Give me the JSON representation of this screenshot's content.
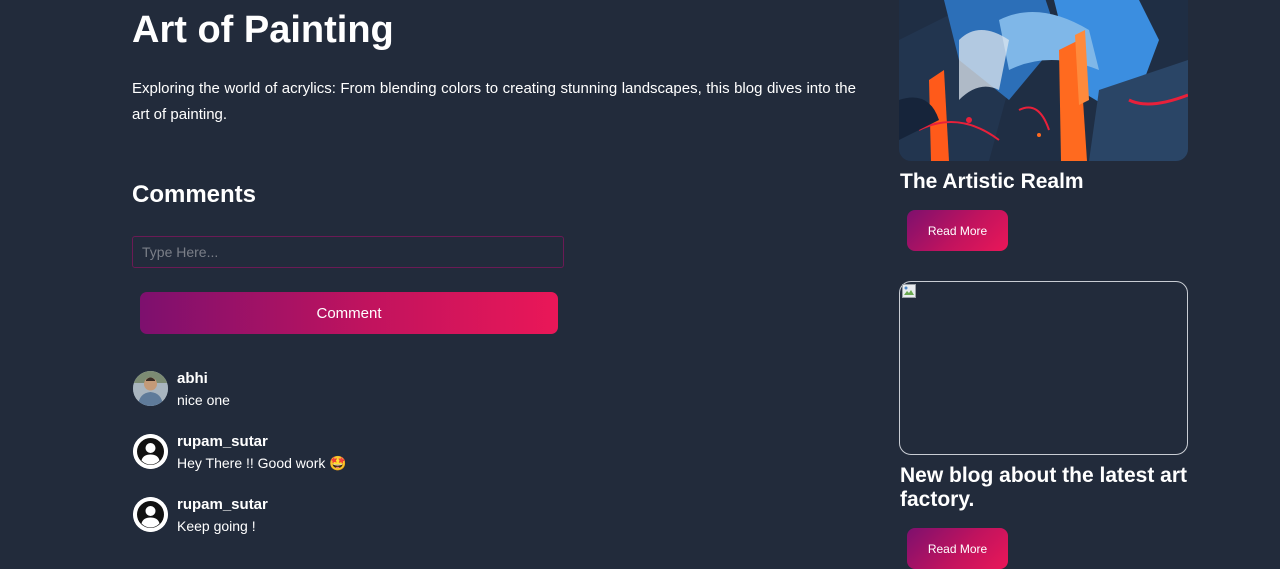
{
  "post": {
    "title": "Art of Painting",
    "description": "Exploring the world of acrylics: From blending colors to creating stunning landscapes, this blog dives into the art of painting."
  },
  "comments_section": {
    "heading": "Comments",
    "input_placeholder": "Type Here...",
    "input_value": "",
    "submit_label": "Comment",
    "items": [
      {
        "user": "abhi",
        "text": "nice one",
        "avatar": "user-photo"
      },
      {
        "user": "rupam_sutar",
        "text": "Hey There !! Good work 🤩",
        "avatar": "default-user-icon"
      },
      {
        "user": "rupam_sutar",
        "text": "Keep going !",
        "avatar": "default-user-icon"
      }
    ]
  },
  "sidebar": {
    "cards": [
      {
        "title": "The Artistic Realm",
        "button_label": "Read More",
        "image": "abstract-painting"
      },
      {
        "title": "New blog about the latest art factory.",
        "button_label": "Read More",
        "image": "broken-image"
      }
    ]
  },
  "colors": {
    "background": "#222b3b",
    "text": "#ffffff",
    "gradient_start": "#7d106e",
    "gradient_end": "#ea1758",
    "input_border": "#6b1a55"
  }
}
